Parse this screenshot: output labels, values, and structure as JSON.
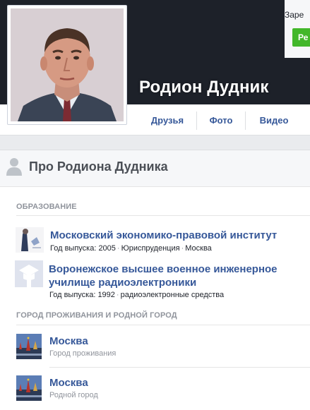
{
  "header": {
    "name": "Родион Дудник",
    "promo_text": "Заре",
    "promo_button": "Ре"
  },
  "nav": {
    "tabs": [
      {
        "label": "Друзья"
      },
      {
        "label": "Фото"
      },
      {
        "label": "Видео"
      }
    ]
  },
  "about": {
    "title": "Про Родиона Дудника",
    "education": {
      "section_label": "ОБРАЗОВАНИЕ",
      "items": [
        {
          "school": "Московский экономико-правовой институт",
          "year": "Год выпуска: 2005",
          "field": "Юриспруденция",
          "city": "Москва"
        },
        {
          "school": "Воронежское высшее военное инженерное училище радиоэлектроники",
          "year": "Год выпуска: 1992",
          "field": "радиоэлектронные средства"
        }
      ]
    },
    "places": {
      "section_label": "ГОРОД ПРОЖИВАНИЯ И РОДНОЙ ГОРОД",
      "items": [
        {
          "city": "Москва",
          "type": "Город проживания"
        },
        {
          "city": "Москва",
          "type": "Родной город"
        }
      ]
    }
  },
  "colors": {
    "link": "#365899",
    "cover": "#1d2129",
    "background": "#e9ebee",
    "button_green": "#42b72a",
    "muted": "#90949c"
  },
  "icons": {
    "header_icon": "person-icon",
    "school_placeholder": "school-icon",
    "city_thumbnail": "moscow-kremlin-thumbnail"
  }
}
